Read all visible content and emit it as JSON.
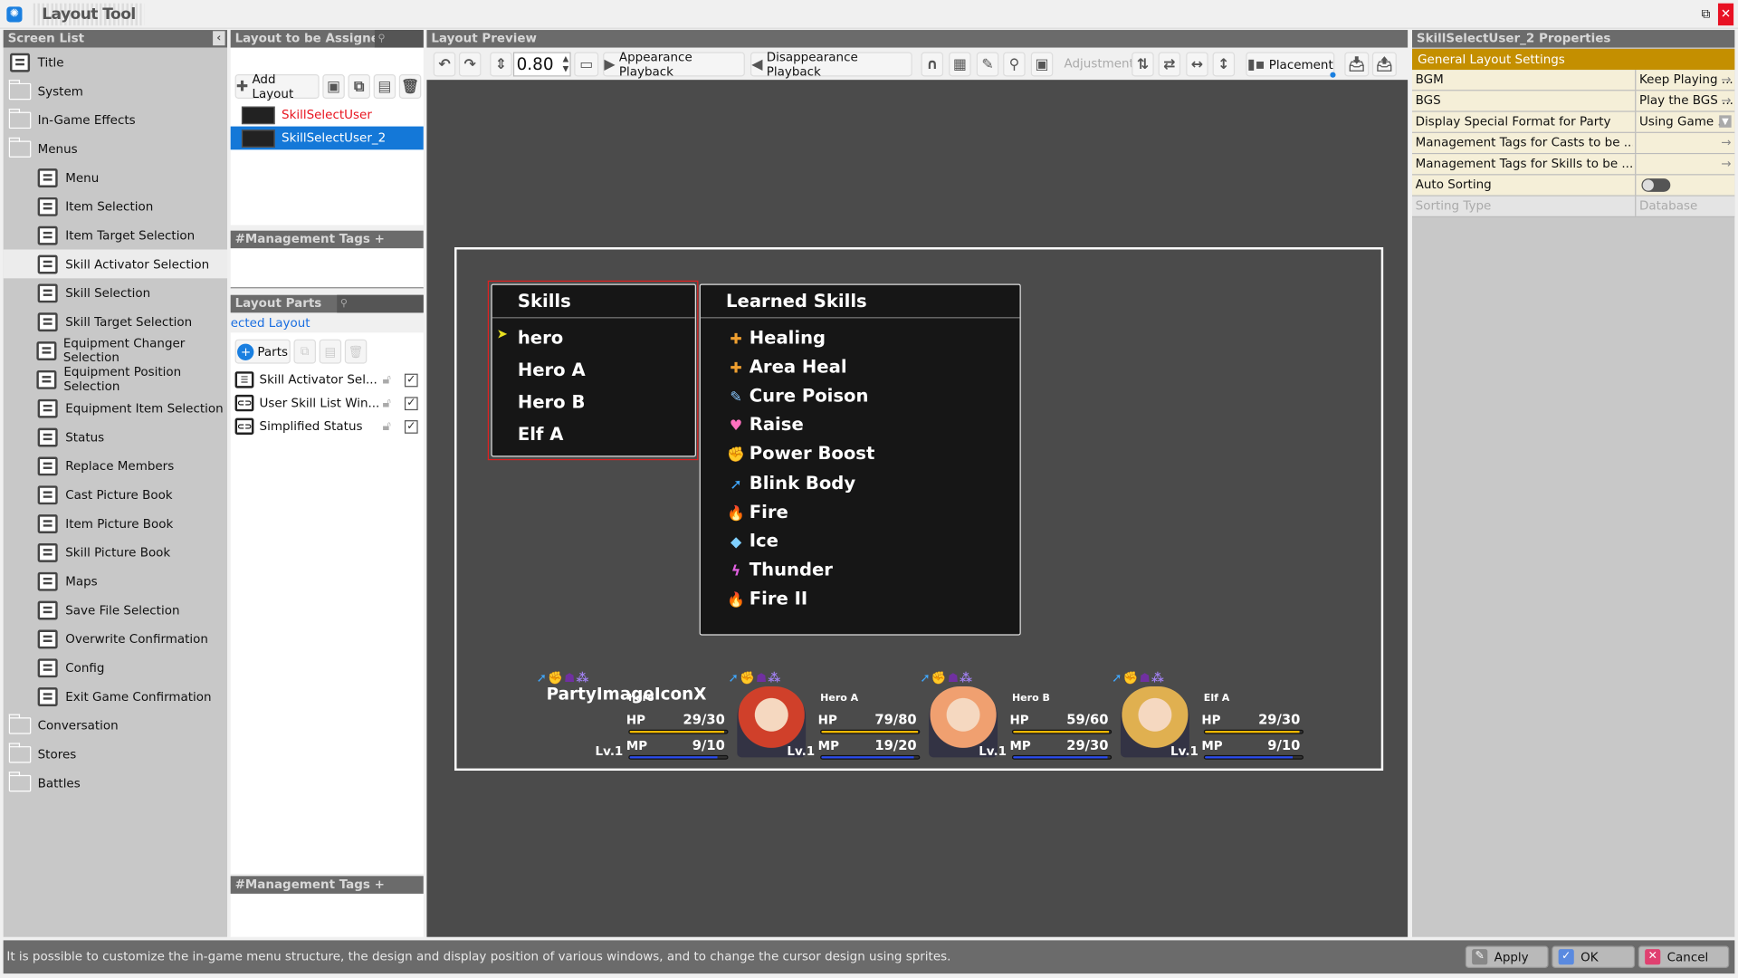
{
  "app": {
    "title": "Layout Tool"
  },
  "screen_list": {
    "header": "Screen List",
    "items": [
      {
        "label": "Title",
        "type": "screen",
        "indent": 0
      },
      {
        "label": "System",
        "type": "folder",
        "indent": 0
      },
      {
        "label": "In-Game Effects",
        "type": "folder",
        "indent": 0
      },
      {
        "label": "Menus",
        "type": "folder",
        "indent": 0
      },
      {
        "label": "Menu",
        "type": "screen",
        "indent": 1
      },
      {
        "label": "Item Selection",
        "type": "screen",
        "indent": 1
      },
      {
        "label": "Item Target Selection",
        "type": "screen",
        "indent": 1
      },
      {
        "label": "Skill Activator Selection",
        "type": "screen",
        "indent": 1,
        "selected": true
      },
      {
        "label": "Skill Selection",
        "type": "screen",
        "indent": 1
      },
      {
        "label": "Skill Target Selection",
        "type": "screen",
        "indent": 1
      },
      {
        "label": "Equipment Changer Selection",
        "type": "screen",
        "indent": 1
      },
      {
        "label": "Equipment Position Selection",
        "type": "screen",
        "indent": 1
      },
      {
        "label": "Equipment Item Selection",
        "type": "screen",
        "indent": 1
      },
      {
        "label": "Status",
        "type": "screen",
        "indent": 1
      },
      {
        "label": "Replace Members",
        "type": "screen",
        "indent": 1
      },
      {
        "label": "Cast Picture Book",
        "type": "screen",
        "indent": 1
      },
      {
        "label": "Item Picture Book",
        "type": "screen",
        "indent": 1
      },
      {
        "label": "Skill Picture Book",
        "type": "screen",
        "indent": 1
      },
      {
        "label": "Maps",
        "type": "screen",
        "indent": 1
      },
      {
        "label": "Save File Selection",
        "type": "screen",
        "indent": 1
      },
      {
        "label": "Overwrite Confirmation",
        "type": "screen",
        "indent": 1
      },
      {
        "label": "Config",
        "type": "screen",
        "indent": 1
      },
      {
        "label": "Exit Game Confirmation",
        "type": "screen",
        "indent": 1
      },
      {
        "label": "Conversation",
        "type": "folder",
        "indent": 0
      },
      {
        "label": "Stores",
        "type": "folder",
        "indent": 0
      },
      {
        "label": "Battles",
        "type": "folder",
        "indent": 0
      }
    ]
  },
  "layouts": {
    "header": "Layout to be Assigned",
    "add_label": "Add Layout",
    "items": [
      {
        "label": "SkillSelectUser",
        "color": "#e8141e"
      },
      {
        "label": "SkillSelectUser_2",
        "selected": true
      }
    ],
    "tags_header": "#Management Tags + Notes"
  },
  "parts": {
    "header": "Layout Parts",
    "link": "ected Layout",
    "add_label": "Parts",
    "items": [
      {
        "label": "Skill Activator Sel...",
        "icon": "list-window-icon"
      },
      {
        "label": "User Skill List Win...",
        "icon": "link-window-icon"
      },
      {
        "label": "Simplified Status",
        "icon": "link-window-icon"
      }
    ],
    "tags_header": "#Management Tags + Notes"
  },
  "preview": {
    "header": "Layout Preview",
    "zoom": "0.80",
    "appearance": "Appearance Playback",
    "disappearance": "Disappearance Playback",
    "adjustment": "Adjustment",
    "placement": "Placement"
  },
  "game": {
    "skills_title": "Skills",
    "actors": [
      "hero",
      "Hero A",
      "Hero B",
      "Elf A"
    ],
    "learned_title": "Learned Skills",
    "skills": [
      {
        "name": "Healing",
        "icon": "✚",
        "color": "#f0a030"
      },
      {
        "name": "Area Heal",
        "icon": "✚",
        "color": "#f0a030"
      },
      {
        "name": "Cure Poison",
        "icon": "✎",
        "color": "#8ac8ff"
      },
      {
        "name": "Raise",
        "icon": "♥",
        "color": "#ff70c0"
      },
      {
        "name": "Power Boost",
        "icon": "✊",
        "color": "#f0c040"
      },
      {
        "name": "Blink Body",
        "icon": "➚",
        "color": "#40a8ff"
      },
      {
        "name": "Fire",
        "icon": "🔥",
        "color": "#ff8020"
      },
      {
        "name": "Ice",
        "icon": "◆",
        "color": "#80d0ff"
      },
      {
        "name": "Thunder",
        "icon": "ϟ",
        "color": "#e060e0"
      },
      {
        "name": "Fire II",
        "icon": "🔥",
        "color": "#ff8020"
      }
    ],
    "overlay_label": "PartyImageIconX",
    "party": [
      {
        "name": "hero",
        "hp": "29/30",
        "mp": "9/10",
        "hp_frac": 0.97,
        "mp_frac": 0.9,
        "lv": "Lv.1",
        "portrait": false
      },
      {
        "name": "Hero A",
        "hp": "79/80",
        "mp": "19/20",
        "hp_frac": 0.99,
        "mp_frac": 0.95,
        "lv": "Lv.1",
        "portrait": "#d0402a"
      },
      {
        "name": "Hero B",
        "hp": "59/60",
        "mp": "29/30",
        "hp_frac": 0.98,
        "mp_frac": 0.97,
        "lv": "Lv.1",
        "portrait": "#f0a070"
      },
      {
        "name": "Elf A",
        "hp": "29/30",
        "mp": "9/10",
        "hp_frac": 0.97,
        "mp_frac": 0.9,
        "lv": "Lv.1",
        "portrait": "#e0b050"
      }
    ],
    "hp_label": "HP",
    "mp_label": "MP",
    "hp_color": "#f5b800",
    "mp_color": "#2a4cf0"
  },
  "props": {
    "header": "SkillSelectUser_2 Properties",
    "section": "General Layout Settings",
    "rows": [
      {
        "key": "BGM",
        "value": "Keep Playing ...",
        "ctrl": "arrow"
      },
      {
        "key": "BGS",
        "value": "Play the BGS ...",
        "ctrl": "arrow"
      },
      {
        "key": "Display Special Format for Party",
        "value": "Using Game ...",
        "ctrl": "dropdown"
      },
      {
        "key": "Management Tags for Casts to be ...",
        "value": "",
        "ctrl": "arrow"
      },
      {
        "key": "Management Tags for Skills to be ...",
        "value": "",
        "ctrl": "arrow"
      },
      {
        "key": "Auto Sorting",
        "value": "",
        "ctrl": "toggle",
        "on": false
      },
      {
        "key": "Sorting Type",
        "value": "Database",
        "ctrl": "disabled"
      }
    ]
  },
  "status": {
    "text": "It is possible to customize the in-game menu structure, the design and display position of various windows, and to change the cursor design using sprites.",
    "apply": "Apply",
    "ok": "OK",
    "cancel": "Cancel"
  }
}
